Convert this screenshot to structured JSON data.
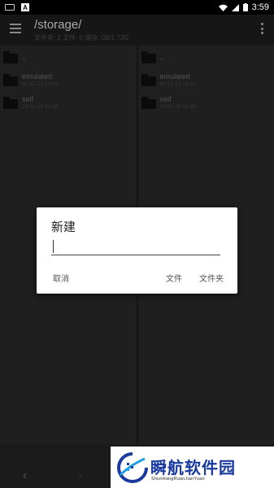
{
  "statusbar": {
    "time": "3:59"
  },
  "toolbar": {
    "title": "/storage/",
    "subtitle": "文件夹: 2  文件: 0  储存: 0B/1.73G"
  },
  "left_pane": {
    "items": [
      {
        "name": "..",
        "date": ""
      },
      {
        "name": "emulated",
        "date": "69-12-22 18:03"
      },
      {
        "name": "self",
        "date": "70-01-19 22:48"
      }
    ]
  },
  "right_pane": {
    "items": [
      {
        "name": "..",
        "date": ""
      },
      {
        "name": "emulated",
        "date": "69-12-22 18:03"
      },
      {
        "name": "self",
        "date": "70-01-19 22:48"
      }
    ]
  },
  "dialog": {
    "title": "新建",
    "input_value": "",
    "cancel_label": "取消",
    "file_label": "文件",
    "folder_label": "文件夹"
  },
  "bottombar": {
    "back_glyph": "‹",
    "forward_glyph": "›"
  },
  "watermark": {
    "title": "瞬航软件园",
    "subtitle": "ShunHangRuanJianYuan"
  },
  "colors": {
    "accent": "#1a3aa0",
    "dialog_bg": "#ffffff",
    "dim_bg": "#1f1f1f"
  }
}
